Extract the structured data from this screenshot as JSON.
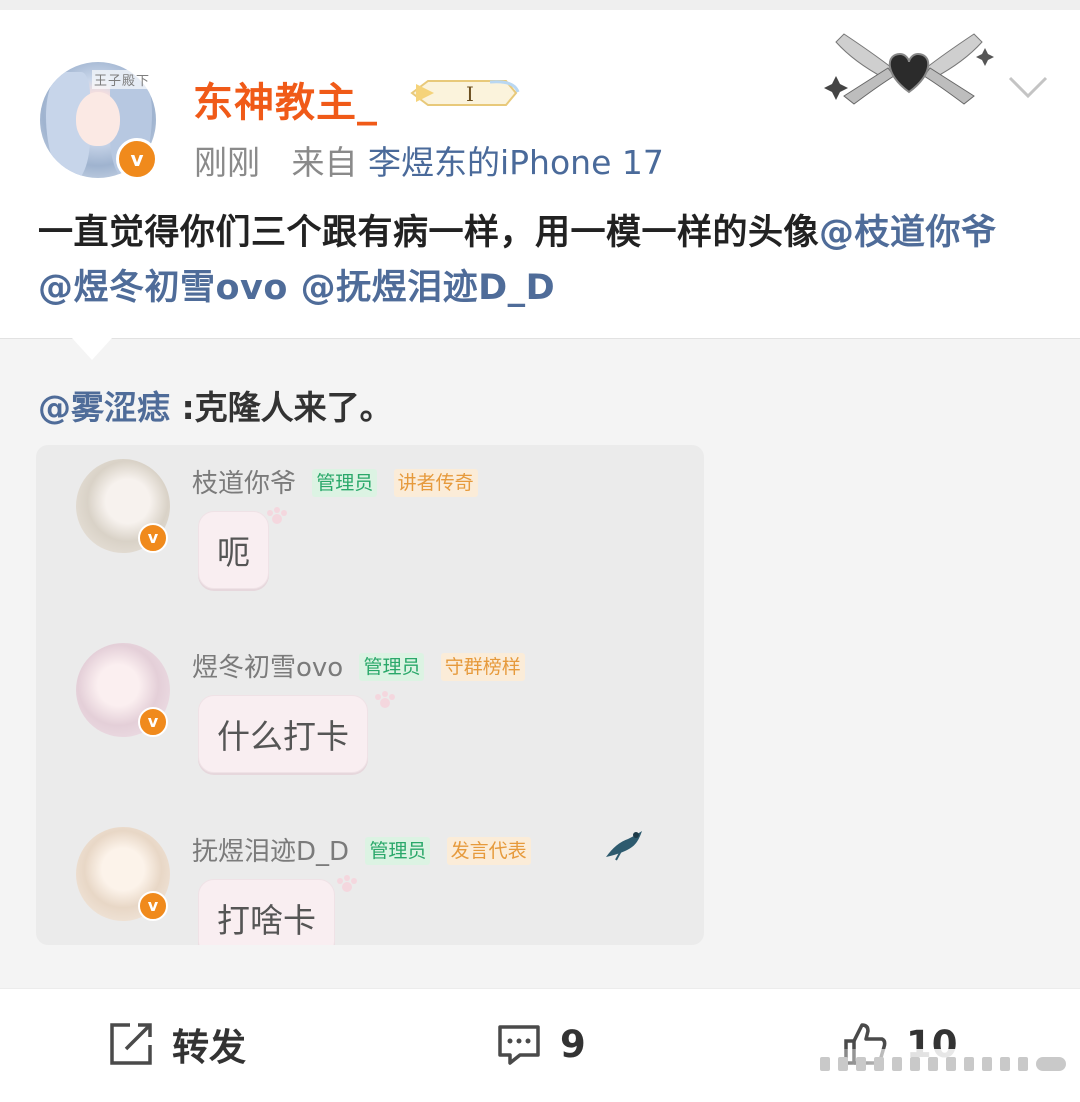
{
  "post": {
    "username": "东神教主_",
    "avatar_watermark": "王子殿下",
    "verified_badge": "v",
    "time": "刚刚",
    "source_prefix": "来自",
    "source": "李煜东的iPhone 17",
    "text_plain": "一直觉得你们三个跟有病一样，用一模一样的头像",
    "mention1": "@枝道你爷",
    "mention2": "@煜冬初雪ovo",
    "mention3": "@抚煜泪迹D_D",
    "icons": {
      "avatar": "user-avatar",
      "level": "level-badge-icon",
      "decoration": "heart-wings-decoration",
      "menu": "chevron-down-icon"
    }
  },
  "repost": {
    "mention": "@雾涩痣",
    "text": " :克隆人来了。",
    "chat": [
      {
        "name": "枝道你爷",
        "tag_admin": "管理员",
        "tag_title": "讲者传奇",
        "message": "呃"
      },
      {
        "name": "煜冬初雪ovo",
        "tag_admin": "管理员",
        "tag_title": "守群榜样",
        "message": "什么打卡"
      },
      {
        "name": "抚煜泪迹D_D",
        "tag_admin": "管理员",
        "tag_title": "发言代表",
        "message": "打啥卡"
      }
    ]
  },
  "actions": {
    "repost_label": "转发",
    "comments_count": "9",
    "likes_count": "10"
  },
  "colors": {
    "username": "#f05a18",
    "mention": "#4f6c99",
    "verified": "#f08a1c",
    "admin_tag": "#2aa86a",
    "title_tag": "#e69a3c"
  }
}
